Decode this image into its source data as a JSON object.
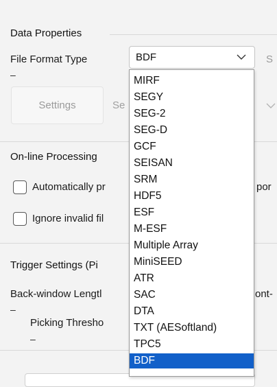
{
  "data_properties": {
    "section_title": "Data Properties",
    "file_format_label": "File Format Type",
    "file_format_value": "BDF",
    "right_cut_text": "S",
    "settings_button": "Settings",
    "settings_cut_text": "Se"
  },
  "online_processing": {
    "section_title": "On-line Processing",
    "auto_process_label": "Automatically pr",
    "auto_process_right_cut": "por",
    "ignore_invalid_label": "Ignore invalid fil"
  },
  "trigger_settings": {
    "section_title": "Trigger Settings (Pi",
    "back_window_label": "Back-window Lengtl",
    "back_window_right_cut": "ont-",
    "picking_threshold_label": "Picking Thresho"
  },
  "dash": "–",
  "dropdown": {
    "options": [
      "MIRF",
      "SEGY",
      "SEG-2",
      "SEG-D",
      "GCF",
      "SEISAN",
      "SRM",
      "HDF5",
      "ESF",
      "M-ESF",
      "Multiple Array",
      "MiniSEED",
      "ATR",
      "SAC",
      "DTA",
      "TXT (AESoftland)",
      "TPC5",
      "BDF"
    ],
    "selected": "BDF",
    "selected_color": "#1260c9"
  }
}
